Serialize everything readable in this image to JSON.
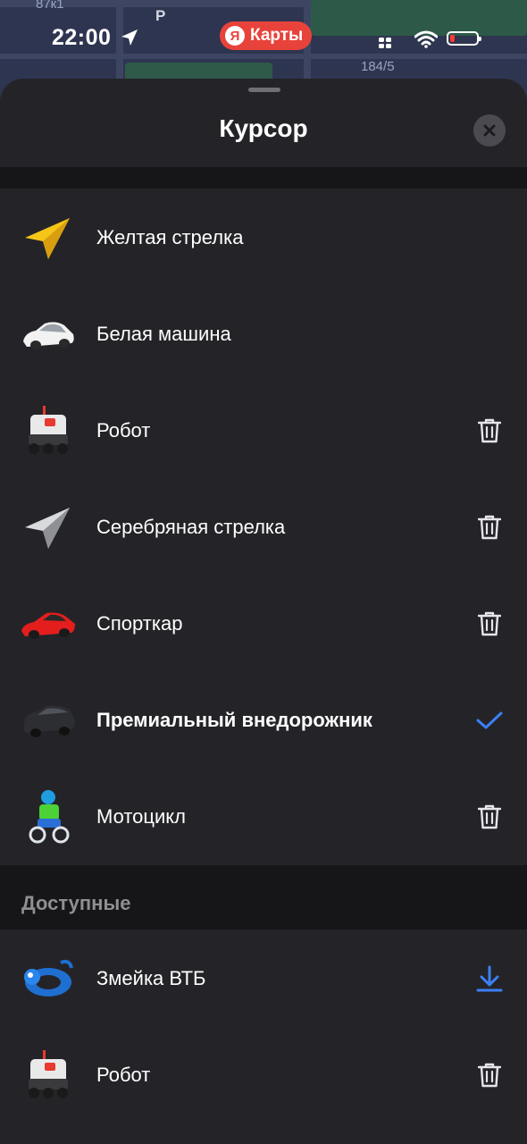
{
  "status": {
    "time": "22:00",
    "app_badge_logo": "Я",
    "app_badge_text": "Карты"
  },
  "map_labels": {
    "house_top": "87к1",
    "parking": "P",
    "house_number": "184/5"
  },
  "sheet": {
    "title": "Курсор",
    "close_icon": "close-icon"
  },
  "cursors": [
    {
      "label": "Желтая стрелка",
      "icon": "yellow-arrow-icon",
      "action": null,
      "selected": false
    },
    {
      "label": "Белая машина",
      "icon": "white-car-icon",
      "action": null,
      "selected": false
    },
    {
      "label": "Робот",
      "icon": "robot-icon",
      "action": "delete",
      "selected": false
    },
    {
      "label": "Серебряная стрелка",
      "icon": "silver-arrow-icon",
      "action": "delete",
      "selected": false
    },
    {
      "label": "Спорткар",
      "icon": "sportscar-icon",
      "action": "delete",
      "selected": false
    },
    {
      "label": "Премиальный внедорожник",
      "icon": "premium-suv-icon",
      "action": "check",
      "selected": true
    },
    {
      "label": "Мотоцикл",
      "icon": "motorcycle-icon",
      "action": "delete",
      "selected": false
    }
  ],
  "available": {
    "header": "Доступные",
    "items": [
      {
        "label": "Змейка ВТБ",
        "icon": "vtb-snake-icon",
        "action": "download"
      },
      {
        "label": "Робот",
        "icon": "robot-icon",
        "action": "delete"
      }
    ]
  },
  "colors": {
    "accent": "#3d7ff5",
    "sheet_bg": "#242428",
    "divider_bg": "#161618",
    "badge_red": "#e8433b"
  }
}
